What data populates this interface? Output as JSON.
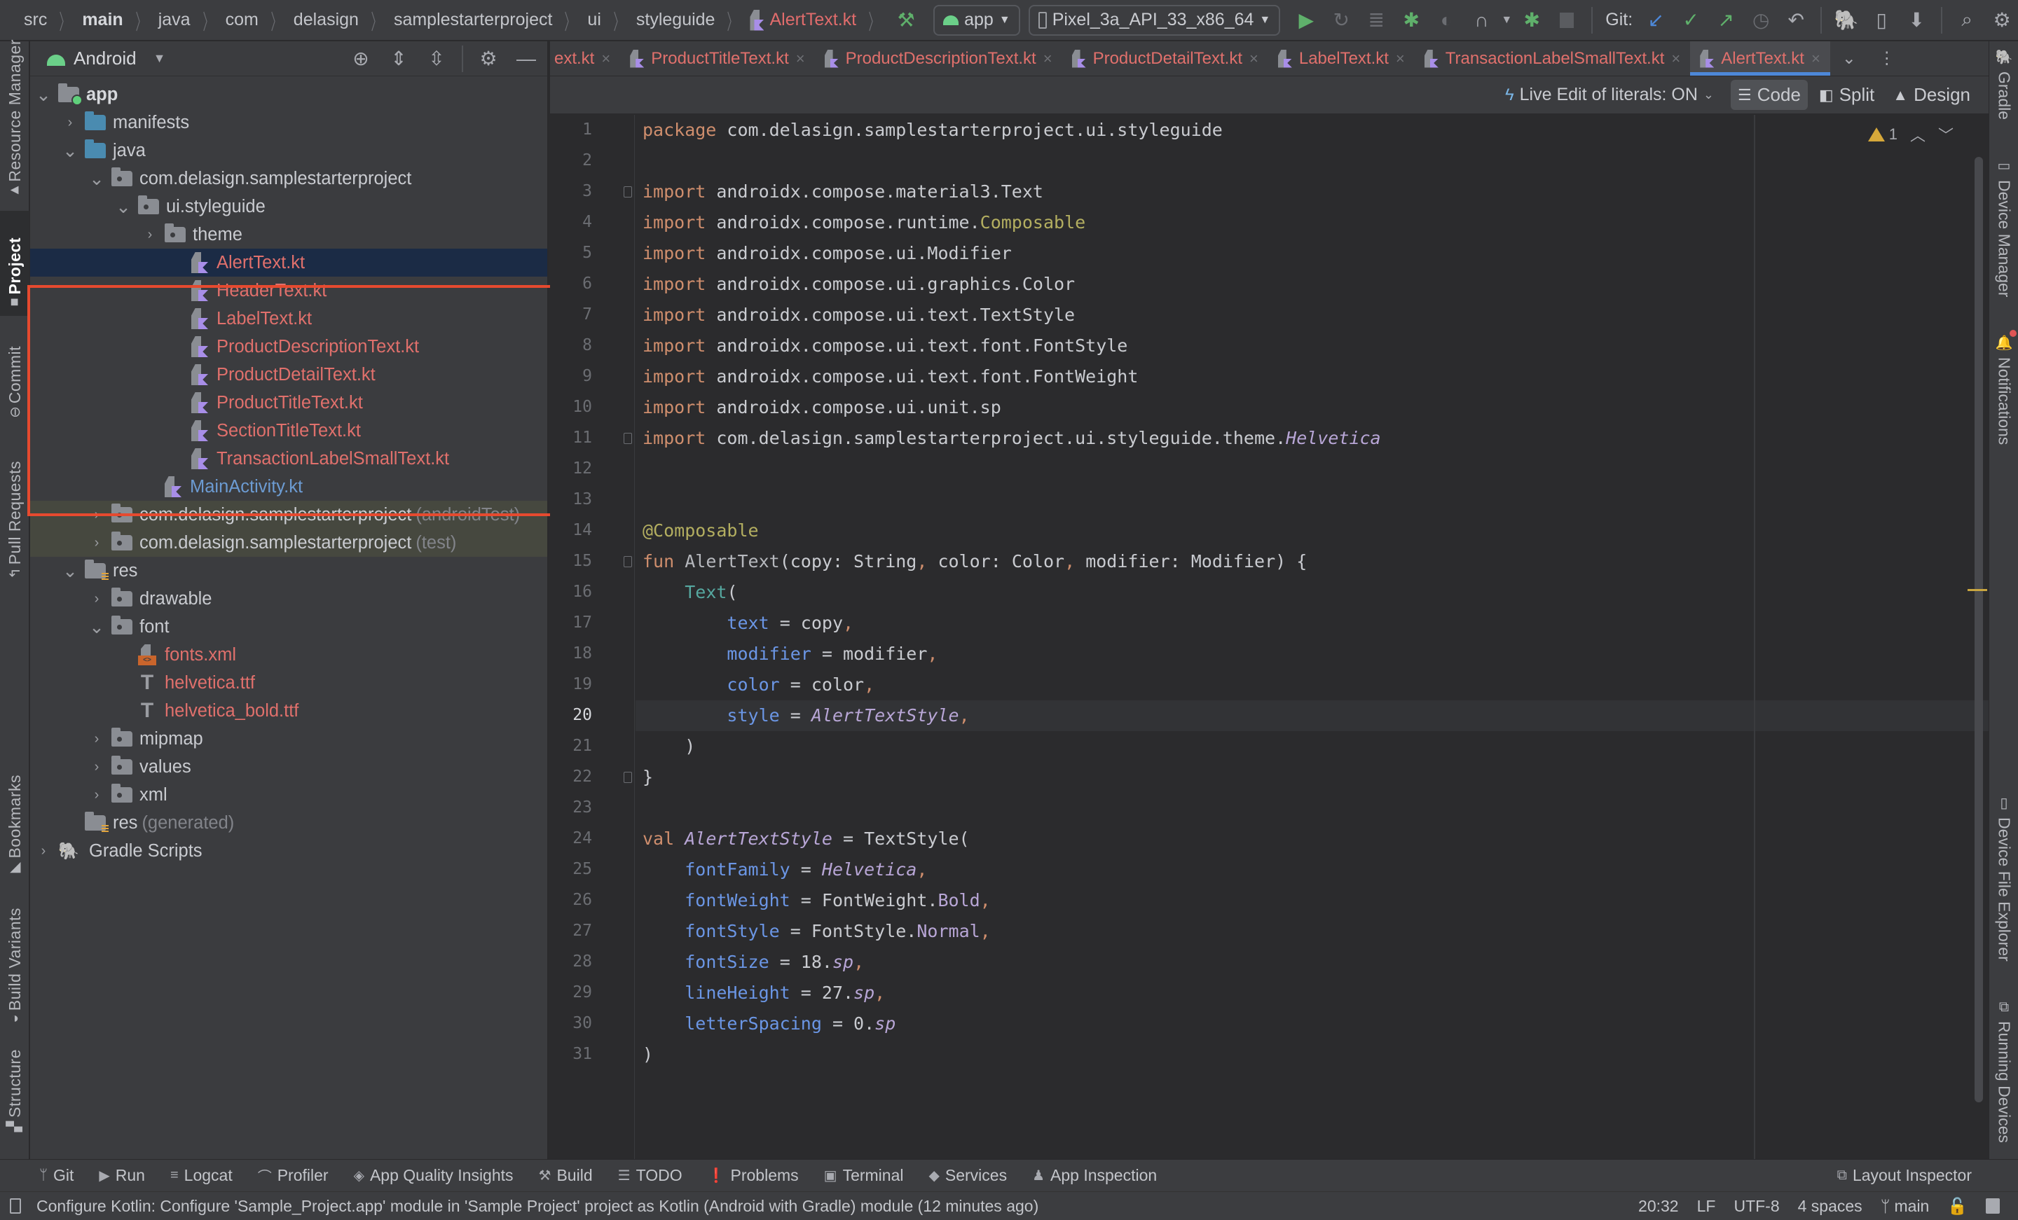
{
  "breadcrumb": [
    "src",
    "main",
    "java",
    "com",
    "delasign",
    "samplestarterproject",
    "ui",
    "styleguide",
    "AlertText.kt"
  ],
  "toolbar": {
    "run_config": "app",
    "device": "Pixel_3a_API_33_x86_64",
    "git_label": "Git:",
    "icons": [
      "hammer-icon",
      "run-icon",
      "apply-changes-icon",
      "apply-code-changes-icon",
      "debug-icon",
      "attach-debugger-icon",
      "profile-icon",
      "stop-icon",
      "git-update-icon",
      "git-commit-icon",
      "git-push-icon",
      "history-icon",
      "rollback-icon",
      "sdk-manager-icon",
      "device-manager-icon",
      "sync-icon",
      "search-icon",
      "settings-icon",
      "avatar"
    ]
  },
  "left_strip": [
    "Resource Manager",
    "Project",
    "Commit",
    "Pull Requests",
    "Bookmarks",
    "Build Variants",
    "Structure"
  ],
  "right_strip": [
    "Gradle",
    "Device Manager",
    "Notifications",
    "Device File Explorer",
    "Running Devices"
  ],
  "project_panel": {
    "view": "Android",
    "tree": [
      {
        "label": "app",
        "depth": 0,
        "expanded": true,
        "icon": "module"
      },
      {
        "label": "manifests",
        "depth": 1,
        "expanded": false,
        "icon": "folder-blue"
      },
      {
        "label": "java",
        "depth": 1,
        "expanded": true,
        "icon": "folder-blue"
      },
      {
        "label": "com.delasign.samplestarterproject",
        "depth": 2,
        "expanded": true,
        "icon": "package"
      },
      {
        "label": "ui.styleguide",
        "depth": 3,
        "expanded": true,
        "icon": "package"
      },
      {
        "label": "theme",
        "depth": 4,
        "expanded": false,
        "icon": "package"
      },
      {
        "label": "AlertText.kt",
        "depth": 5,
        "icon": "kotlin",
        "color": "red",
        "selected": true
      },
      {
        "label": "HeaderText.kt",
        "depth": 5,
        "icon": "kotlin",
        "color": "red"
      },
      {
        "label": "LabelText.kt",
        "depth": 5,
        "icon": "kotlin",
        "color": "red"
      },
      {
        "label": "ProductDescriptionText.kt",
        "depth": 5,
        "icon": "kotlin",
        "color": "red"
      },
      {
        "label": "ProductDetailText.kt",
        "depth": 5,
        "icon": "kotlin",
        "color": "red"
      },
      {
        "label": "ProductTitleText.kt",
        "depth": 5,
        "icon": "kotlin",
        "color": "red"
      },
      {
        "label": "SectionTitleText.kt",
        "depth": 5,
        "icon": "kotlin",
        "color": "red"
      },
      {
        "label": "TransactionLabelSmallText.kt",
        "depth": 5,
        "icon": "kotlin",
        "color": "red"
      },
      {
        "label": "MainActivity.kt",
        "depth": 4,
        "icon": "kotlin",
        "color": "blue"
      },
      {
        "label": "com.delasign.samplestarterproject",
        "suffix": "(androidTest)",
        "depth": 2,
        "expanded": false,
        "icon": "package",
        "test": true
      },
      {
        "label": "com.delasign.samplestarterproject",
        "suffix": "(test)",
        "depth": 2,
        "expanded": false,
        "icon": "package",
        "test": true
      },
      {
        "label": "res",
        "depth": 1,
        "expanded": true,
        "icon": "res"
      },
      {
        "label": "drawable",
        "depth": 2,
        "expanded": false,
        "icon": "package"
      },
      {
        "label": "font",
        "depth": 2,
        "expanded": true,
        "icon": "package"
      },
      {
        "label": "fonts.xml",
        "depth": 3,
        "icon": "xml",
        "color": "red"
      },
      {
        "label": "helvetica.ttf",
        "depth": 3,
        "icon": "ttf",
        "color": "red"
      },
      {
        "label": "helvetica_bold.ttf",
        "depth": 3,
        "icon": "ttf",
        "color": "red"
      },
      {
        "label": "mipmap",
        "depth": 2,
        "expanded": false,
        "icon": "package"
      },
      {
        "label": "values",
        "depth": 2,
        "expanded": false,
        "icon": "package"
      },
      {
        "label": "xml",
        "depth": 2,
        "expanded": false,
        "icon": "package"
      },
      {
        "label": "res",
        "suffix": "(generated)",
        "depth": 1,
        "icon": "res"
      },
      {
        "label": "Gradle Scripts",
        "depth": 0,
        "expanded": false,
        "icon": "gradle"
      }
    ]
  },
  "editor": {
    "tabs": [
      {
        "label": "ext.kt",
        "partial": true
      },
      {
        "label": "ProductTitleText.kt"
      },
      {
        "label": "ProductDescriptionText.kt"
      },
      {
        "label": "ProductDetailText.kt"
      },
      {
        "label": "LabelText.kt"
      },
      {
        "label": "TransactionLabelSmallText.kt"
      },
      {
        "label": "AlertText.kt",
        "active": true
      }
    ],
    "live_edit": "Live Edit of literals: ON",
    "modes": [
      "Code",
      "Split",
      "Design"
    ],
    "active_mode": "Code",
    "warnings": "1",
    "current_line": 20,
    "lines": [
      [
        [
          "kw",
          "package"
        ],
        [
          "lit",
          " com.delasign.samplestarterproject.ui.styleguide"
        ]
      ],
      [],
      [
        [
          "kw",
          "import"
        ],
        [
          "lit",
          " androidx.compose.material3.Text"
        ]
      ],
      [
        [
          "kw",
          "import"
        ],
        [
          "lit",
          " androidx.compose.runtime."
        ],
        [
          "ann",
          "Composable"
        ]
      ],
      [
        [
          "kw",
          "import"
        ],
        [
          "lit",
          " androidx.compose.ui.Modifier"
        ]
      ],
      [
        [
          "kw",
          "import"
        ],
        [
          "lit",
          " androidx.compose.ui.graphics.Color"
        ]
      ],
      [
        [
          "kw",
          "import"
        ],
        [
          "lit",
          " androidx.compose.ui.text.TextStyle"
        ]
      ],
      [
        [
          "kw",
          "import"
        ],
        [
          "lit",
          " androidx.compose.ui.text.font.FontStyle"
        ]
      ],
      [
        [
          "kw",
          "import"
        ],
        [
          "lit",
          " androidx.compose.ui.text.font.FontWeight"
        ]
      ],
      [
        [
          "kw",
          "import"
        ],
        [
          "lit",
          " androidx.compose.ui.unit.sp"
        ]
      ],
      [
        [
          "kw",
          "import"
        ],
        [
          "lit",
          " com.delasign.samplestarterproject.ui.styleguide.theme."
        ],
        [
          "it2",
          "Helvetica"
        ]
      ],
      [],
      [],
      [
        [
          "ann",
          "@Composable"
        ]
      ],
      [
        [
          "kw",
          "fun "
        ],
        [
          "fn",
          "AlertText"
        ],
        [
          "lit",
          "(copy: String"
        ],
        [
          "comma",
          ","
        ],
        [
          "lit",
          " color: Color"
        ],
        [
          "comma",
          ","
        ],
        [
          "lit",
          " modifier: Modifier) {"
        ]
      ],
      [
        [
          "lit",
          "    "
        ],
        [
          "call",
          "Text"
        ],
        [
          "lit",
          "("
        ]
      ],
      [
        [
          "lit",
          "        "
        ],
        [
          "param",
          "text"
        ],
        [
          "lit",
          " = copy"
        ],
        [
          "comma",
          ","
        ]
      ],
      [
        [
          "lit",
          "        "
        ],
        [
          "param",
          "modifier"
        ],
        [
          "lit",
          " = modifier"
        ],
        [
          "comma",
          ","
        ]
      ],
      [
        [
          "lit",
          "        "
        ],
        [
          "param",
          "color"
        ],
        [
          "lit",
          " = color"
        ],
        [
          "comma",
          ","
        ]
      ],
      [
        [
          "lit",
          "        "
        ],
        [
          "param",
          "style"
        ],
        [
          "lit",
          " = "
        ],
        [
          "it2",
          "AlertTextStyle"
        ],
        [
          "comma",
          ","
        ]
      ],
      [
        [
          "lit",
          "    )"
        ]
      ],
      [
        [
          "lit",
          "}"
        ]
      ],
      [],
      [
        [
          "kw",
          "val "
        ],
        [
          "it2",
          "AlertTextStyle"
        ],
        [
          "lit",
          " = TextStyle("
        ]
      ],
      [
        [
          "lit",
          "    "
        ],
        [
          "param",
          "fontFamily"
        ],
        [
          "lit",
          " = "
        ],
        [
          "it2",
          "Helvetica"
        ],
        [
          "comma",
          ","
        ]
      ],
      [
        [
          "lit",
          "    "
        ],
        [
          "param",
          "fontWeight"
        ],
        [
          "lit",
          " = FontWeight."
        ],
        [
          "prop",
          "Bold"
        ],
        [
          "comma",
          ","
        ]
      ],
      [
        [
          "lit",
          "    "
        ],
        [
          "param",
          "fontStyle"
        ],
        [
          "lit",
          " = FontStyle."
        ],
        [
          "prop",
          "Normal"
        ],
        [
          "comma",
          ","
        ]
      ],
      [
        [
          "lit",
          "    "
        ],
        [
          "param",
          "fontSize"
        ],
        [
          "lit",
          " = 18."
        ],
        [
          "it2",
          "sp"
        ],
        [
          "comma",
          ","
        ]
      ],
      [
        [
          "lit",
          "    "
        ],
        [
          "param",
          "lineHeight"
        ],
        [
          "lit",
          " = 27."
        ],
        [
          "it2",
          "sp"
        ],
        [
          "comma",
          ","
        ]
      ],
      [
        [
          "lit",
          "    "
        ],
        [
          "param",
          "letterSpacing"
        ],
        [
          "lit",
          " = 0."
        ],
        [
          "it2",
          "sp"
        ]
      ],
      [
        [
          "lit",
          ")"
        ]
      ]
    ],
    "fold_lines": [
      3,
      11,
      15,
      22
    ]
  },
  "bottom_tools": [
    {
      "label": "Git",
      "icon": "git-branch-icon",
      "glyph": "ᛘ"
    },
    {
      "label": "Run",
      "icon": "run-icon",
      "glyph": "▶"
    },
    {
      "label": "Logcat",
      "icon": "logcat-icon",
      "glyph": "≡"
    },
    {
      "label": "Profiler",
      "icon": "profiler-icon",
      "glyph": "⌒"
    },
    {
      "label": "App Quality Insights",
      "icon": "insights-icon",
      "glyph": "◈"
    },
    {
      "label": "Build",
      "icon": "hammer-icon",
      "glyph": "⚒"
    },
    {
      "label": "TODO",
      "icon": "todo-icon",
      "glyph": "☰"
    },
    {
      "label": "Problems",
      "icon": "problems-icon",
      "glyph": "❗"
    },
    {
      "label": "Terminal",
      "icon": "terminal-icon",
      "glyph": "▣"
    },
    {
      "label": "Services",
      "icon": "services-icon",
      "glyph": "◆"
    },
    {
      "label": "App Inspection",
      "icon": "app-inspection-icon",
      "glyph": "♟"
    }
  ],
  "layout_inspector": "Layout Inspector",
  "status": {
    "message": "Configure Kotlin: Configure 'Sample_Project.app' module in 'Sample Project' project as Kotlin (Android with Gradle) module (12 minutes ago)",
    "position": "20:32",
    "line_sep": "LF",
    "encoding": "UTF-8",
    "indent": "4 spaces",
    "branch": "main"
  },
  "colors": {
    "accent": "#4d88d8",
    "highlight_box": "#e64a2f",
    "modified_file": "#e0706c",
    "selection": "#1b2b45"
  }
}
